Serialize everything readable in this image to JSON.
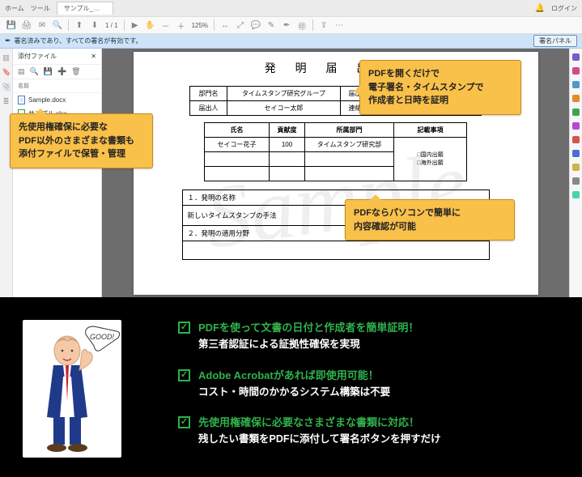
{
  "app": {
    "tabs": {
      "home": "ホーム",
      "tools": "ツール",
      "file": "サンプル_発明届出..."
    },
    "login": "ログイン",
    "toolbar": {
      "zoom": "125%"
    },
    "signbar": {
      "msg": "署名済みであり、すべての署名が有効です。",
      "panelBtn": "署名パネル"
    }
  },
  "sidepanel": {
    "title": "添付ファイル",
    "nameHeader": "名前",
    "items": [
      {
        "name": "Sample.docx"
      },
      {
        "name": "サンプル.xlsx"
      }
    ]
  },
  "doc": {
    "title": "発 明 届 出 書",
    "watermark": "Sample",
    "top": {
      "dept_l": "部門名",
      "dept_v": "タイムスタンプ研究グループ",
      "date_l": "届出日",
      "date_v": "",
      "sub_l": "届出人",
      "sub_v": "セイコー太郎",
      "contact_l": "連絡先",
      "contact_v": ""
    },
    "mid": {
      "h_name": "氏名",
      "h_cont": "貢献度",
      "h_dept": "所属部門",
      "h_notes": "記載事項",
      "r1_name": "セイコー花子",
      "r1_cont": "100",
      "r1_dept": "タイムスタンプ研究部",
      "chk1": "国内出願",
      "chk2": "海外出願"
    },
    "s1_h": "１．発明の名称",
    "s1_b": "新しいタイムスタンプの手法",
    "s2_h": "２．発明の適用分野"
  },
  "callouts": {
    "c1": "先使用権確保に必要な\nPDF以外のさまざまな書類も\n添付ファイルで保管・管理",
    "c2": "PDFを開くだけで\n電子署名・タイムスタンプで\n作成者と日時を証明",
    "c3": "PDFならパソコンで簡単に\n内容確認が可能"
  },
  "benefits": {
    "bubble": "GOOD!",
    "items": [
      {
        "l1": "PDFを使って文書の日付と作成者を簡単証明！",
        "l2": "第三者認証による証拠性確保を実現"
      },
      {
        "l1": "Adobe Acrobatがあれば即使用可能！",
        "l2": "コスト・時間のかかるシステム構築は不要"
      },
      {
        "l1": "先使用権確保に必要なさまざまな書類に対応！",
        "l2": "残したい書類をPDFに添付して署名ボタンを押すだけ"
      }
    ]
  }
}
